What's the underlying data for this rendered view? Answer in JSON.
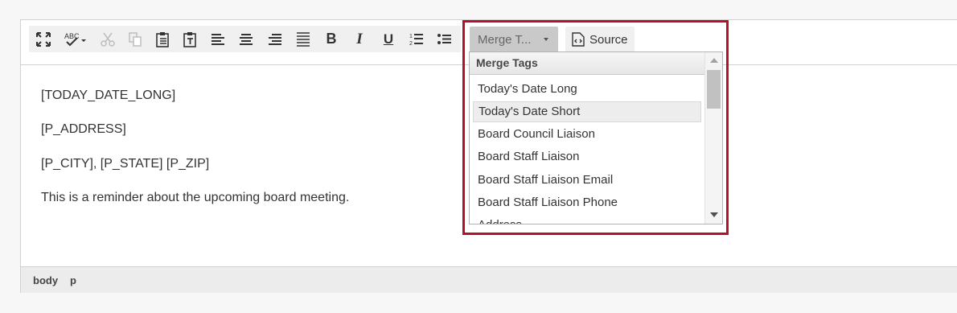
{
  "toolbar": {
    "buttons": [
      {
        "icon": "maximize-icon",
        "enabled": true
      },
      {
        "icon": "spellcheck-icon",
        "label": "ABC",
        "enabled": true
      },
      {
        "icon": "cut-icon",
        "enabled": false
      },
      {
        "icon": "copy-icon",
        "enabled": false
      },
      {
        "icon": "paste-icon",
        "enabled": true
      },
      {
        "icon": "paste-text-icon",
        "enabled": true
      },
      {
        "icon": "align-left-icon",
        "enabled": true
      },
      {
        "icon": "align-center-icon",
        "enabled": true
      },
      {
        "icon": "align-right-icon",
        "enabled": true
      },
      {
        "icon": "justify-icon",
        "enabled": true
      },
      {
        "icon": "bold-icon",
        "label": "B",
        "enabled": true
      },
      {
        "icon": "italic-icon",
        "label": "I",
        "enabled": true
      },
      {
        "icon": "underline-icon",
        "label": "U",
        "enabled": true
      },
      {
        "icon": "numbered-list-icon",
        "enabled": true
      },
      {
        "icon": "bulleted-list-icon",
        "enabled": true
      }
    ],
    "merge_label": "Merge T...",
    "source_label": "Source"
  },
  "content": {
    "lines": [
      "[TODAY_DATE_LONG]",
      "[P_ADDRESS]",
      "[P_CITY], [P_STATE] [P_ZIP]",
      "This is a reminder about the upcoming board meeting."
    ]
  },
  "merge_panel": {
    "title": "Merge Tags",
    "items": [
      "Today's Date Long",
      "Today's Date Short",
      "Board Council Liaison",
      "Board Staff Liaison",
      "Board Staff Liaison Email",
      "Board Staff Liaison Phone",
      "Address"
    ],
    "selected_index": 1
  },
  "pathbar": {
    "items": [
      "body",
      "p"
    ]
  },
  "colors": {
    "highlight": "#b5112b",
    "merge_button": "#c9c9c9",
    "toolbar_group": "#f0f0f0"
  }
}
